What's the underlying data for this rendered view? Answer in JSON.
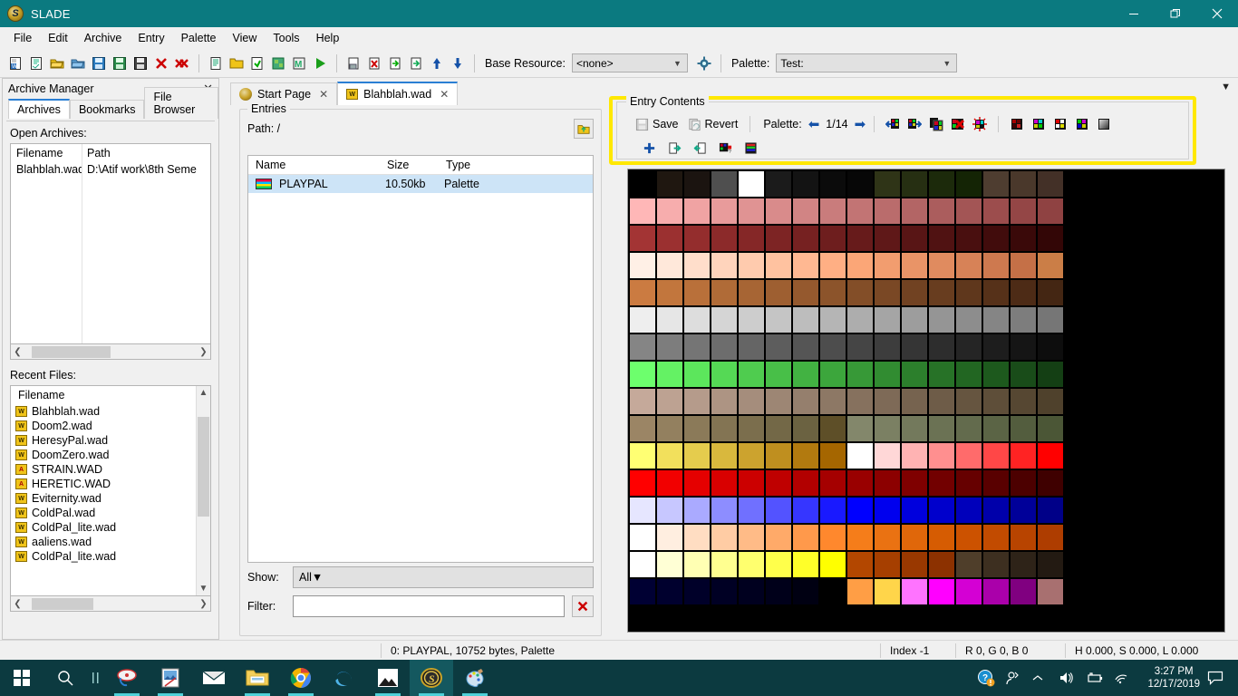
{
  "window": {
    "title": "SLADE",
    "minimize_label": "–",
    "maximize_label": "❐",
    "close_label": "✕"
  },
  "menubar": {
    "items": [
      {
        "label": "File"
      },
      {
        "label": "Edit"
      },
      {
        "label": "Archive"
      },
      {
        "label": "Entry"
      },
      {
        "label": "Palette"
      },
      {
        "label": "View"
      },
      {
        "label": "Tools"
      },
      {
        "label": "Help"
      }
    ]
  },
  "toolbar": {
    "base_resource_label": "Base Resource:",
    "base_resource_value": "<none>",
    "palette_label": "Palette:",
    "palette_value": "Test:",
    "icons": [
      "new-archive-icon",
      "new-entry-icon",
      "open-archive-icon",
      "open-folder-icon",
      "save-icon",
      "save-as-icon",
      "save-all-icon",
      "close-archive-icon",
      "close-all-icon",
      "new-text-entry-icon",
      "new-directory-icon",
      "import-files-icon",
      "texture-editor-icon",
      "map-editor-icon",
      "run-archive-icon",
      "entry-properties-icon",
      "delete-entry-icon",
      "import-entry-icon",
      "export-entry-icon",
      "move-up-icon",
      "move-down-icon"
    ],
    "settings_icon": "gear-icon"
  },
  "archive_manager": {
    "title": "Archive Manager",
    "close_icon": "close-icon",
    "tabs": [
      {
        "label": "Archives",
        "active": true
      },
      {
        "label": "Bookmarks",
        "active": false
      },
      {
        "label": "File Browser",
        "active": false
      }
    ],
    "open_archives_label": "Open Archives:",
    "open_archives_columns": [
      "Filename",
      "Path"
    ],
    "open_archives_rows": [
      {
        "filename": "Blahblah.wad",
        "path": "D:\\Atif work\\8th Seme"
      }
    ],
    "recent_files_label": "Recent Files:",
    "recent_files_column": "Filename",
    "recent_files": [
      {
        "name": "Blahblah.wad",
        "icon": "wad-icon"
      },
      {
        "name": "Doom2.wad",
        "icon": "wad-icon"
      },
      {
        "name": "HeresyPal.wad",
        "icon": "wad-icon"
      },
      {
        "name": "DoomZero.wad",
        "icon": "wad-icon"
      },
      {
        "name": "STRAIN.WAD",
        "icon": "zip-icon"
      },
      {
        "name": "HERETIC.WAD",
        "icon": "zip-icon"
      },
      {
        "name": "Eviternity.wad",
        "icon": "wad-icon"
      },
      {
        "name": "ColdPal.wad",
        "icon": "wad-icon"
      },
      {
        "name": "ColdPal_lite.wad",
        "icon": "wad-icon"
      },
      {
        "name": "aaliens.wad",
        "icon": "wad-icon"
      },
      {
        "name": "ColdPal_lite.wad",
        "icon": "wad-icon"
      }
    ]
  },
  "document_tabs": [
    {
      "label": "Start Page",
      "icon": "slade-logo-icon",
      "active": false,
      "close_icon": "✕"
    },
    {
      "label": "Blahblah.wad",
      "icon": "wad-icon",
      "active": true,
      "close_icon": "✕"
    }
  ],
  "entries": {
    "group_title": "Entries",
    "path_label": "Path: /",
    "up_icon": "folder-up-icon",
    "columns": [
      "Name",
      "Size",
      "Type"
    ],
    "rows": [
      {
        "name": "PLAYPAL",
        "size": "10.50kb",
        "type": "Palette",
        "icon": "palette-entry-icon",
        "selected": true
      }
    ],
    "show_label": "Show:",
    "show_value": "All",
    "filter_label": "Filter:",
    "filter_value": "",
    "filter_placeholder": "",
    "filter_clear_icon": "clear-x-icon"
  },
  "entry_contents": {
    "group_title": "Entry Contents",
    "save_label": "Save",
    "save_icon": "save-disk-icon",
    "revert_label": "Revert",
    "revert_icon": "revert-icon",
    "palette_label": "Palette:",
    "prev_icon": "arrow-left-icon",
    "page_indicator": "1/14",
    "next_icon": "arrow-right-icon",
    "tool_icons_row1": [
      "load-palette-icon",
      "save-palette-icon",
      "duplicate-palette-icon",
      "remove-palette-icon",
      "generate-palettes-icon",
      "colourise-icon",
      "tint-icon",
      "invert-icon",
      "tweak-colours-icon",
      "greyscale-icon"
    ],
    "tool_icons_row2": [
      "add-colour-icon",
      "export-palette-icon",
      "import-palette-icon",
      "palette-gradient-icon",
      "palette-swatch-icon"
    ],
    "collapse_icon": "chevron-down-icon"
  },
  "status_bar": {
    "entry_info": "0: PLAYPAL, 10752 bytes, Palette",
    "index": "Index -1",
    "rgb": "R 0, G 0, B 0",
    "hsl": "H 0.000, S 0.000, L 0.000"
  },
  "taskbar": {
    "start_icon": "windows-start-icon",
    "search_icon": "search-icon",
    "task_view_icon": "task-view-icon",
    "items": [
      {
        "icon": "paint-net-icon",
        "running": false
      },
      {
        "icon": "photo-viewer-icon",
        "running": false
      },
      {
        "icon": "mail-icon",
        "running": false
      },
      {
        "icon": "file-explorer-icon",
        "running": true
      },
      {
        "icon": "chrome-icon",
        "running": true
      },
      {
        "icon": "edge-icon",
        "running": false
      },
      {
        "icon": "photos-icon",
        "running": true
      },
      {
        "icon": "slade-icon",
        "running": true,
        "active": true
      },
      {
        "icon": "paint-icon",
        "running": true
      }
    ],
    "tray": {
      "help_icon": "help-circle-icon",
      "people_icon": "people-icon",
      "chevron_icon": "chevron-up-icon",
      "volume_icon": "speaker-icon",
      "battery_icon": "battery-icon",
      "network_icon": "wifi-icon",
      "time": "3:27 PM",
      "date": "12/17/2019",
      "action_center_icon": "notification-icon"
    }
  },
  "palette_grid": {
    "columns": 16,
    "rows": 16,
    "colors": [
      "#000000",
      "#1f1710",
      "#1b1410",
      "#4f4f4f",
      "#ffffff",
      "#1b1b1b",
      "#131313",
      "#0b0b0b",
      "#070707",
      "#2f3417",
      "#262f12",
      "#1c2a0b",
      "#142405",
      "#4e3d30",
      "#4a382b",
      "#433027",
      "#ffb7b7",
      "#f7adad",
      "#f0a3a3",
      "#e89b9b",
      "#e09393",
      "#d98b8b",
      "#d18484",
      "#c97c7c",
      "#c27474",
      "#ba6c6c",
      "#b36565",
      "#ab5d5d",
      "#a35555",
      "#9c4d4d",
      "#944646",
      "#8f4242",
      "#a33434",
      "#9b3030",
      "#942d2d",
      "#8c2a2a",
      "#852727",
      "#7d2424",
      "#762121",
      "#6e1e1e",
      "#671b1b",
      "#5f1818",
      "#581515",
      "#501212",
      "#490f0f",
      "#410c0c",
      "#3a0909",
      "#330606",
      "#fff0e6",
      "#ffe8da",
      "#ffdecb",
      "#ffd4bc",
      "#ffcbae",
      "#ffc2a0",
      "#ffb892",
      "#ffaf84",
      "#fba677",
      "#f29d6f",
      "#e99467",
      "#e08b5f",
      "#d78257",
      "#ce794f",
      "#c57047",
      "#cb7e47",
      "#cb7b41",
      "#c2763d",
      "#b9703a",
      "#b06b37",
      "#a76534",
      "#9e5f31",
      "#95592e",
      "#8c542b",
      "#834e28",
      "#7a4825",
      "#714222",
      "#683d1f",
      "#5f371c",
      "#563119",
      "#4d2b16",
      "#442613",
      "#eeeeee",
      "#e6e6e6",
      "#dddddd",
      "#d5d5d5",
      "#cdcdcd",
      "#c5c5c5",
      "#bdbdbd",
      "#b5b5b5",
      "#adadad",
      "#a5a5a5",
      "#9d9d9d",
      "#959595",
      "#8d8d8d",
      "#858585",
      "#7d7d7d",
      "#767676",
      "#858585",
      "#7d7d7d",
      "#757575",
      "#6d6d6d",
      "#656565",
      "#5d5d5d",
      "#555555",
      "#4d4d4d",
      "#454545",
      "#3d3d3d",
      "#353535",
      "#2d2d2d",
      "#252525",
      "#1d1d1d",
      "#151515",
      "#0d0d0d",
      "#6dff6d",
      "#64f264",
      "#5ce65c",
      "#55d955",
      "#4fcc4f",
      "#48bf48",
      "#42b242",
      "#3ca63c",
      "#379937",
      "#318c31",
      "#2c7f2c",
      "#277227",
      "#226622",
      "#1d591d",
      "#194c19",
      "#143f14",
      "#c5a99a",
      "#bda292",
      "#b59b8b",
      "#ad9483",
      "#a58d7c",
      "#9d8674",
      "#957f6d",
      "#8d7865",
      "#86715e",
      "#7e6a57",
      "#76634f",
      "#6e5c48",
      "#665540",
      "#5e4e39",
      "#564732",
      "#4f412c",
      "#9b8565",
      "#93805f",
      "#8b7a59",
      "#837453",
      "#7b6e4d",
      "#736847",
      "#6b6241",
      "#5e4f28",
      "#83876b",
      "#7b8063",
      "#73795c",
      "#6b7254",
      "#636b4d",
      "#5b6445",
      "#535d3e",
      "#4b5636",
      "#ffff73",
      "#f2e05c",
      "#e5cc4d",
      "#d9b83d",
      "#cca32e",
      "#bf8f1f",
      "#b27a0f",
      "#a56600",
      "#ffffff",
      "#ffd7d7",
      "#ffb3b3",
      "#ff8f8f",
      "#ff6b6b",
      "#ff4747",
      "#ff2323",
      "#ff0000",
      "#ff0000",
      "#f20000",
      "#e50000",
      "#d90000",
      "#cc0000",
      "#bf0000",
      "#b20000",
      "#a50000",
      "#990000",
      "#8c0000",
      "#7f0000",
      "#720000",
      "#660000",
      "#590000",
      "#4c0000",
      "#3f0000",
      "#e6e6ff",
      "#c7c7ff",
      "#aaaaff",
      "#8d8dff",
      "#7070ff",
      "#5353ff",
      "#3636ff",
      "#1919ff",
      "#0000ff",
      "#0000ee",
      "#0000dd",
      "#0000cc",
      "#0000bb",
      "#0000aa",
      "#000099",
      "#000088",
      "#ffffff",
      "#ffeee0",
      "#ffddc2",
      "#ffcca4",
      "#ffbb87",
      "#ffaa69",
      "#ff994b",
      "#ff882d",
      "#f57d1a",
      "#ea7212",
      "#e0670a",
      "#d65c02",
      "#cc5200",
      "#c24b00",
      "#b84400",
      "#ae3d00",
      "#ffffff",
      "#ffffd5",
      "#ffffb3",
      "#ffff90",
      "#ffff6e",
      "#ffff4b",
      "#ffff29",
      "#ffff00",
      "#b34700",
      "#a63f00",
      "#993800",
      "#8c3100",
      "#4f3e2a",
      "#3d2f20",
      "#2e2318",
      "#231a12",
      "#000033",
      "#00002e",
      "#000029",
      "#000024",
      "#00001f",
      "#00001a",
      "#000012",
      "#000000",
      "#ff9e45",
      "#ffd54a",
      "#ff73ff",
      "#ff00ff",
      "#d400d4",
      "#aa00aa",
      "#800080",
      "#a87070"
    ]
  }
}
